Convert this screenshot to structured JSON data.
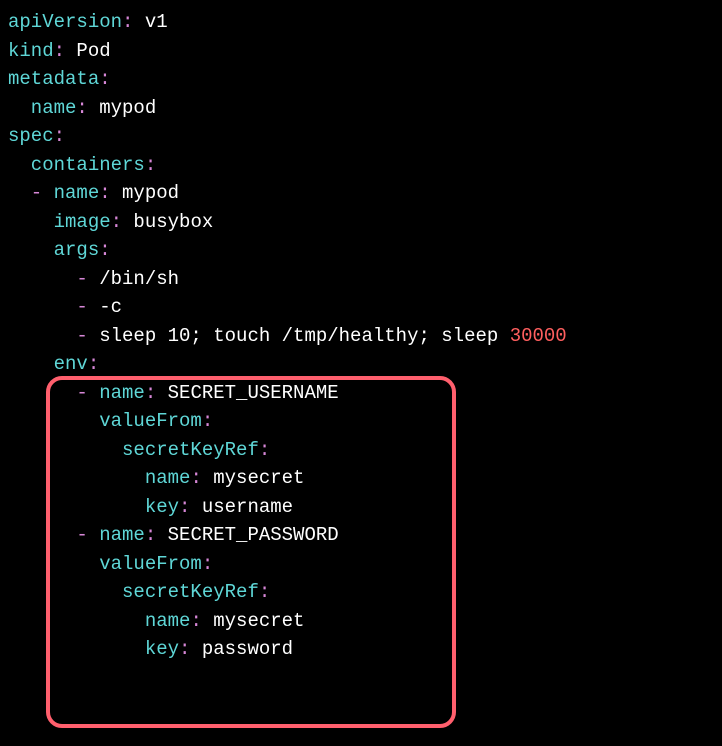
{
  "l1": {
    "k": "apiVersion",
    "c": ":",
    "v": " v1"
  },
  "l2": {
    "k": "kind",
    "c": ":",
    "v": " Pod"
  },
  "l3": {
    "k": "metadata",
    "c": ":"
  },
  "l4": {
    "k": "  name",
    "c": ":",
    "v": " mypod"
  },
  "l5": {
    "k": "spec",
    "c": ":"
  },
  "l6": {
    "k": "  containers",
    "c": ":"
  },
  "l7": {
    "d": "  - ",
    "k": "name",
    "c": ":",
    "v": " mypod"
  },
  "l8": {
    "k": "    image",
    "c": ":",
    "v": " busybox"
  },
  "l9": {
    "k": "    args",
    "c": ":"
  },
  "l10": {
    "d": "      - ",
    "v": "/bin/sh"
  },
  "l11": {
    "d": "      - ",
    "v": "-c"
  },
  "l12": {
    "d": "      - ",
    "v": "sleep 10; touch /tmp/healthy; sleep ",
    "n": "30000"
  },
  "l13": {
    "k": "    env",
    "c": ":"
  },
  "l14": {
    "d": "      - ",
    "k": "name",
    "c": ":",
    "v": " SECRET_USERNAME"
  },
  "l15": {
    "k": "        valueFrom",
    "c": ":"
  },
  "l16": {
    "k": "          secretKeyRef",
    "c": ":"
  },
  "l17": {
    "k": "            name",
    "c": ":",
    "v": " mysecret"
  },
  "l18": {
    "k": "            key",
    "c": ":",
    "v": " username"
  },
  "l19": {
    "d": "      - ",
    "k": "name",
    "c": ":",
    "v": " SECRET_PASSWORD"
  },
  "l20": {
    "k": "        valueFrom",
    "c": ":"
  },
  "l21": {
    "k": "          secretKeyRef",
    "c": ":"
  },
  "l22": {
    "k": "            name",
    "c": ":",
    "v": " mysecret"
  },
  "l23": {
    "k": "            key",
    "c": ":",
    "v": " password"
  }
}
